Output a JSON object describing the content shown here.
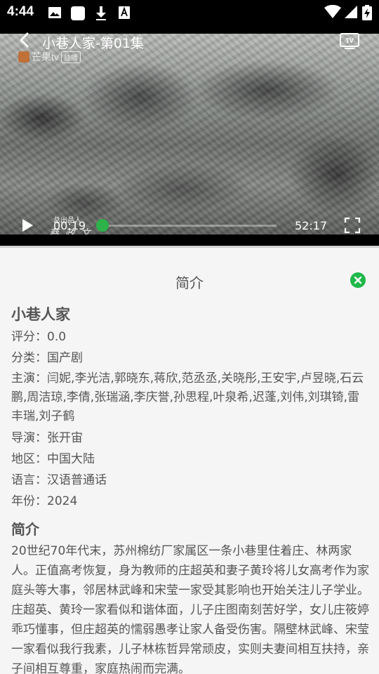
{
  "status_bar": {
    "time": "4:44",
    "icons": [
      "image-icon",
      "square-notification-icon",
      "download-icon",
      "font-icon"
    ],
    "right_icons": [
      "wifi-icon",
      "signal-icon",
      "battery-charging-icon"
    ]
  },
  "player": {
    "title": "小巷人家-第01集",
    "watermark_brand": "芒果tv",
    "watermark_badge": "独播",
    "credit_role": "总出品人",
    "credit_name": "蔡 政 文",
    "current_time": "00:19",
    "total_time": "52:17",
    "progress_fraction": 0.006,
    "accent_color": "#2db34a"
  },
  "sheet": {
    "header": "简介",
    "show_name": "小巷人家",
    "rating": "评分：0.0",
    "category": "分类：国产剧",
    "cast": "主演：闫妮,李光洁,郭晓东,蒋欣,范丞丞,关晓彤,王安宇,卢昱晓,石云鹏,周洁琼,李倩,张瑞涵,李庆誉,孙思程,叶泉希,迟蓬,刘伟,刘琪锜,雷丰瑞,刘子鹤",
    "director": "导演：张开宙",
    "region": "地区：中国大陆",
    "language": "语言：汉语普通话",
    "year": "年份：2024",
    "synopsis_title": "简介",
    "synopsis": "20世纪70年代末，苏州棉纺厂家属区一条小巷里住着庄、林两家人。正值高考恢复，身为教师的庄超英和妻子黄玲将儿女高考作为家庭头等大事，邻居林武峰和宋莹一家受其影响也开始关注儿子学业。庄超英、黄玲一家看似和谐体面，儿子庄图南刻苦好学，女儿庄筱婷乖巧懂事，但庄超英的懦弱愚孝让家人备受伤害。隔壁林武峰、宋莹一家看似我行我素，儿子林栋哲异常顽皮，实则夫妻间相互扶持，亲子间相互尊重，家庭热闹而完满。"
  }
}
